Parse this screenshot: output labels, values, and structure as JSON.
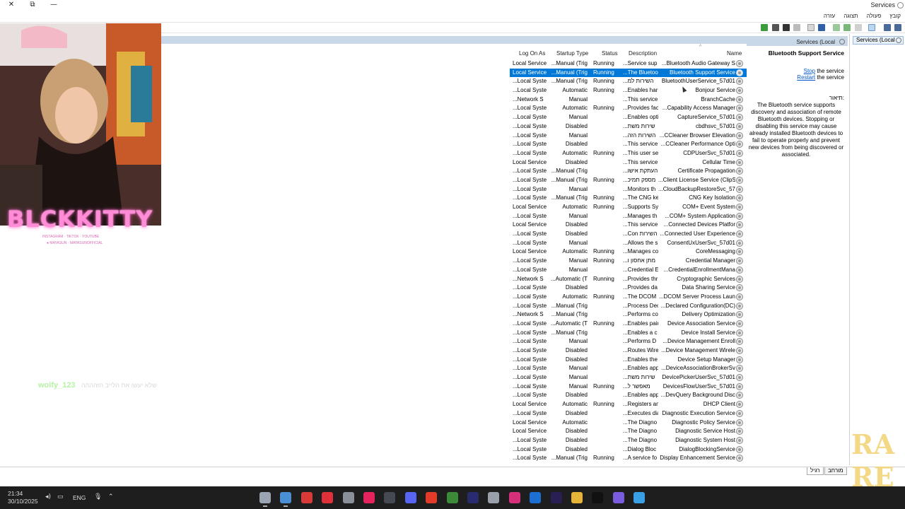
{
  "window": {
    "title": "Services",
    "controls": {
      "close": "✕",
      "restore": "⧉",
      "minimize": "—"
    }
  },
  "menu": [
    "קובץ",
    "פעולה",
    "תצוגה",
    "עזרה"
  ],
  "tree": {
    "node_label": "Services (Local"
  },
  "main_header": {
    "label": "Services (Local"
  },
  "columns": {
    "name": "Name",
    "description": "Description",
    "status": "Status",
    "startup": "Startup Type",
    "logon": "Log On As"
  },
  "services": [
    {
      "name": "...Bluetooth Audio Gateway S",
      "desc": "...Service sup",
      "status": "Running",
      "startup": "...Manual (Trig",
      "logon": "Local Service"
    },
    {
      "name": "Bluetooth Support Service",
      "desc": "...The Bluetoo",
      "status": "Running",
      "startup": "...Manual (Trig",
      "logon": "Local Service"
    },
    {
      "name": "BluetoothUserService_57d01",
      "desc": "...השירות למ",
      "status": "Running",
      "startup": "...Manual (Trig",
      "logon": "...Local Syste"
    },
    {
      "name": "Bonjour Service",
      "desc": "...Enables har",
      "status": "Running",
      "startup": "Automatic",
      "logon": "...Local Syste"
    },
    {
      "name": "BranchCache",
      "desc": "...This service",
      "status": "",
      "startup": "Manual",
      "logon": "...Network S"
    },
    {
      "name": "...Capability Access Manager",
      "desc": "...Provides fac",
      "status": "Running",
      "startup": "Automatic",
      "logon": "...Local Syste"
    },
    {
      "name": "CaptureService_57d01",
      "desc": "...Enables opti",
      "status": "",
      "startup": "Manual",
      "logon": "...Local Syste"
    },
    {
      "name": "cbdhsvc_57d01",
      "desc": "...שירות משת",
      "status": "",
      "startup": "Disabled",
      "logon": "...Local Syste"
    },
    {
      "name": "...CCleaner Browser Elevation",
      "desc": "...השירות הזה",
      "status": "",
      "startup": "Manual",
      "logon": "...Local Syste"
    },
    {
      "name": "...CCleaner Performance Opti",
      "desc": "...This service",
      "status": "",
      "startup": "Disabled",
      "logon": "...Local Syste"
    },
    {
      "name": "CDPUserSvc_57d01",
      "desc": "...This user se",
      "status": "Running",
      "startup": "Automatic",
      "logon": "...Local Syste"
    },
    {
      "name": "Cellular Time",
      "desc": "...This service",
      "status": "",
      "startup": "Disabled",
      "logon": "Local Service"
    },
    {
      "name": "Certificate Propagation",
      "desc": "...העתקת אישו",
      "status": "",
      "startup": "...Manual (Trig",
      "logon": "...Local Syste"
    },
    {
      "name": "...Client License Service (ClipS",
      "desc": "...מספק תמיכ",
      "status": "Running",
      "startup": "...Manual (Trig",
      "logon": "...Local Syste"
    },
    {
      "name": "...CloudBackupRestoreSvc_57",
      "desc": "...Monitors th",
      "status": "",
      "startup": "Manual",
      "logon": "...Local Syste"
    },
    {
      "name": "CNG Key Isolation",
      "desc": "...The CNG ke",
      "status": "Running",
      "startup": "...Manual (Trig",
      "logon": "...Local Syste"
    },
    {
      "name": "COM+ Event System",
      "desc": "...Supports Sy",
      "status": "Running",
      "startup": "Automatic",
      "logon": "Local Service"
    },
    {
      "name": "...COM+ System Application",
      "desc": "...Manages th",
      "status": "",
      "startup": "Manual",
      "logon": "...Local Syste"
    },
    {
      "name": "...Connected Devices Platfor",
      "desc": "...This service",
      "status": "",
      "startup": "Disabled",
      "logon": "Local Service"
    },
    {
      "name": "...Connected User Experience",
      "desc": "...Con השירות",
      "status": "",
      "startup": "Disabled",
      "logon": "...Local Syste"
    },
    {
      "name": "ConsentUxUserSvc_57d01",
      "desc": "...Allows the s",
      "status": "",
      "startup": "Manual",
      "logon": "...Local Syste"
    },
    {
      "name": "CoreMessaging",
      "desc": "...Manages co",
      "status": "Running",
      "startup": "Automatic",
      "logon": "Local Service"
    },
    {
      "name": "Credential Manager",
      "desc": "...מתן אחסון ו",
      "status": "Running",
      "startup": "Manual",
      "logon": "...Local Syste"
    },
    {
      "name": "...CredentialEnrollmentMana",
      "desc": "...Credential E",
      "status": "",
      "startup": "Manual",
      "logon": "...Local Syste"
    },
    {
      "name": "Cryptographic Services",
      "desc": "...Provides thr",
      "status": "Running",
      "startup": "...Automatic (T",
      "logon": "...Network S"
    },
    {
      "name": "Data Sharing Service",
      "desc": "...Provides da",
      "status": "",
      "startup": "Disabled",
      "logon": "...Local Syste"
    },
    {
      "name": "...DCOM Server Process Laun",
      "desc": "...The DCOM",
      "status": "Running",
      "startup": "Automatic",
      "logon": "...Local Syste"
    },
    {
      "name": "...Declared Configuration(DC)",
      "desc": "...Process Dec",
      "status": "",
      "startup": "...Manual (Trig",
      "logon": "...Local Syste"
    },
    {
      "name": "Delivery Optimization",
      "desc": "...Performs co",
      "status": "",
      "startup": "...Manual (Trig",
      "logon": "...Network S"
    },
    {
      "name": "Device Association Service",
      "desc": "...Enables pair",
      "status": "Running",
      "startup": "...Automatic (T",
      "logon": "...Local Syste"
    },
    {
      "name": "Device Install Service",
      "desc": "...Enables a c",
      "status": "",
      "startup": "...Manual (Trig",
      "logon": "...Local Syste"
    },
    {
      "name": "...Device Management Enroll",
      "desc": "...Performs D",
      "status": "",
      "startup": "Manual",
      "logon": "...Local Syste"
    },
    {
      "name": "...Device Management Wirele",
      "desc": "...Routes Wire",
      "status": "",
      "startup": "Disabled",
      "logon": "...Local Syste"
    },
    {
      "name": "Device Setup Manager",
      "desc": "...Enables the",
      "status": "",
      "startup": "Disabled",
      "logon": "...Local Syste"
    },
    {
      "name": "...DeviceAssociationBrokerSv",
      "desc": "...Enables app",
      "status": "",
      "startup": "Manual",
      "logon": "...Local Syste"
    },
    {
      "name": "DevicePickerUserSvc_57d01",
      "desc": "...שירות משת",
      "status": "",
      "startup": "Manual",
      "logon": "...Local Syste"
    },
    {
      "name": "DevicesFlowUserSvc_57d01",
      "desc": "...מאפשר ל",
      "status": "Running",
      "startup": "Manual",
      "logon": "...Local Syste"
    },
    {
      "name": "...DevQuery Background Disc",
      "desc": "...Enables app",
      "status": "",
      "startup": "Disabled",
      "logon": "...Local Syste"
    },
    {
      "name": "DHCP Client",
      "desc": "...Registers an",
      "status": "Running",
      "startup": "Automatic",
      "logon": "Local Service"
    },
    {
      "name": "Diagnostic Execution Service",
      "desc": "...Executes dia",
      "status": "",
      "startup": "Disabled",
      "logon": "...Local Syste"
    },
    {
      "name": "Diagnostic Policy Service",
      "desc": "...The Diagno",
      "status": "",
      "startup": "Automatic",
      "logon": "Local Service"
    },
    {
      "name": "Diagnostic Service Host",
      "desc": "...The Diagno",
      "status": "",
      "startup": "Disabled",
      "logon": "Local Service"
    },
    {
      "name": "Diagnostic System Host",
      "desc": "...The Diagno",
      "status": "",
      "startup": "Disabled",
      "logon": "...Local Syste"
    },
    {
      "name": "DialogBlockingService",
      "desc": "...Dialog Bloc",
      "status": "",
      "startup": "Disabled",
      "logon": "...Local Syste"
    },
    {
      "name": "Display Enhancement Service",
      "desc": "...A service fo",
      "status": "Running",
      "startup": "...Manual (Trig",
      "logon": "...Local Syste"
    }
  ],
  "selected_service_index": 1,
  "extended": {
    "name": "Bluetooth Support Service",
    "stop_link": "Stop",
    "stop_suffix": " the service",
    "restart_link": "Restart",
    "restart_suffix": " the service",
    "description_label": "תיאור:",
    "description": "The Bluetooth service supports discovery and association of remote Bluetooth devices.  Stopping or disabling this service may cause already installed Bluetooth devices to fail to operate properly and prevent new devices from being discovered or associated."
  },
  "bottom_tabs": {
    "extended": "מורחב",
    "standard": "רגיל"
  },
  "taskbar": {
    "time": "21:34",
    "date": "30/10/2025",
    "lang": "ENG",
    "apps": [
      {
        "name": "settings-gear",
        "color": "#9aa4b2"
      },
      {
        "name": "remote-desktop",
        "color": "#4a8fd4"
      },
      {
        "name": "app-red-1",
        "color": "#d83a3a"
      },
      {
        "name": "app-red-2",
        "color": "#e0303a"
      },
      {
        "name": "settings-2",
        "color": "#8a9098"
      },
      {
        "name": "tiktok-live",
        "color": "#e5245e"
      },
      {
        "name": "obs",
        "color": "#444a52"
      },
      {
        "name": "discord",
        "color": "#5865f2"
      },
      {
        "name": "app-red-3",
        "color": "#e23b2a"
      },
      {
        "name": "chrome",
        "color": "#3b8a3a"
      },
      {
        "name": "after-effects",
        "color": "#2a2a6e"
      },
      {
        "name": "app-shield",
        "color": "#9aa0aa"
      },
      {
        "name": "instagram",
        "color": "#d6307a"
      },
      {
        "name": "outlook",
        "color": "#1c6fd0"
      },
      {
        "name": "premiere",
        "color": "#2a1f55"
      },
      {
        "name": "explorer",
        "color": "#e7b43a"
      },
      {
        "name": "tiktok",
        "color": "#111111"
      },
      {
        "name": "copilot",
        "color": "#7a5ce0"
      },
      {
        "name": "windows-start",
        "color": "#3aa0e6"
      }
    ]
  },
  "stream_overlay": {
    "name": "BLCKKITTY",
    "social": "INSTAGRAM · TIKTOK · YOUTUBE",
    "handle": "● MAYASUN · MAYASUNOFFICIAL",
    "chat_user": "woify_123",
    "chat_message": "שלא יעשו את הלייב הזהההה"
  },
  "colors": {
    "selection": "#0078d7",
    "header_strip": "#c8d8e8",
    "accent_link": "#0055cc"
  }
}
